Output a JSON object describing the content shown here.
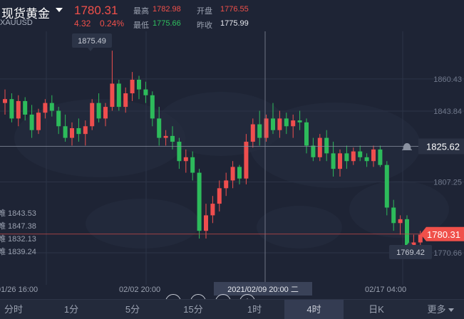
{
  "header": {
    "name": "现货黄金",
    "symbol": "XAUUSD",
    "price": "1780.31",
    "change": "4.32",
    "change_pct": "0.24%",
    "stats": {
      "high_label": "最高",
      "high": "1782.98",
      "open_label": "开盘",
      "open": "1776.55",
      "low_label": "最低",
      "low": "1775.66",
      "prev_label": "昨收",
      "prev": "1775.99"
    }
  },
  "chart": {
    "y_ticks": [
      "1860.43",
      "1843.84",
      "1807.25",
      "1770.66"
    ],
    "crosshair_price": "1825.62",
    "last_price": "1780.31",
    "high_callout": "1875.49",
    "low_callout": "1769.42",
    "ma_legend": [
      "1843.53",
      "1847.38",
      "1832.13",
      "1839.24"
    ],
    "x_ticks": [
      "01/26 16:00",
      "02/02 20:00",
      "02/17 04:00"
    ],
    "crosshair_time": "2021/02/09 20:00 二",
    "colors": {
      "up": "#ef4e4e",
      "down": "#2dbb5b",
      "bg": "#1e2435"
    }
  },
  "chart_data": {
    "type": "candlestick",
    "ylim": [
      1760,
      1885
    ],
    "y_ticks": [
      1860.43,
      1843.84,
      1807.25,
      1770.66
    ],
    "x_ticks": [
      "01/26 16:00",
      "02/02 20:00",
      "02/17 04:00"
    ],
    "ohlc": [
      [
        1848,
        1855,
        1842,
        1850
      ],
      [
        1850,
        1853,
        1838,
        1840
      ],
      [
        1840,
        1852,
        1836,
        1849
      ],
      [
        1849,
        1851,
        1839,
        1842
      ],
      [
        1842,
        1847,
        1830,
        1834
      ],
      [
        1834,
        1845,
        1832,
        1843
      ],
      [
        1843,
        1850,
        1840,
        1848
      ],
      [
        1848,
        1852,
        1841,
        1844
      ],
      [
        1844,
        1846,
        1832,
        1836
      ],
      [
        1836,
        1842,
        1828,
        1830
      ],
      [
        1830,
        1838,
        1826,
        1835
      ],
      [
        1835,
        1840,
        1828,
        1832
      ],
      [
        1832,
        1839,
        1826,
        1836
      ],
      [
        1836,
        1850,
        1834,
        1848
      ],
      [
        1848,
        1853,
        1838,
        1840
      ],
      [
        1840,
        1848,
        1836,
        1846
      ],
      [
        1846,
        1875,
        1844,
        1858
      ],
      [
        1858,
        1860,
        1844,
        1846
      ],
      [
        1846,
        1856,
        1843,
        1853
      ],
      [
        1853,
        1864,
        1849,
        1860
      ],
      [
        1860,
        1862,
        1850,
        1855
      ],
      [
        1855,
        1859,
        1848,
        1852
      ],
      [
        1852,
        1854,
        1836,
        1840
      ],
      [
        1840,
        1846,
        1826,
        1830
      ],
      [
        1830,
        1834,
        1826,
        1831
      ],
      [
        1831,
        1836,
        1824,
        1828
      ],
      [
        1828,
        1830,
        1814,
        1818
      ],
      [
        1818,
        1824,
        1812,
        1820
      ],
      [
        1820,
        1823,
        1808,
        1812
      ],
      [
        1812,
        1814,
        1778,
        1782
      ],
      [
        1782,
        1796,
        1778,
        1790
      ],
      [
        1790,
        1800,
        1786,
        1796
      ],
      [
        1796,
        1808,
        1792,
        1804
      ],
      [
        1804,
        1812,
        1800,
        1808
      ],
      [
        1808,
        1818,
        1804,
        1815
      ],
      [
        1815,
        1816,
        1806,
        1809
      ],
      [
        1809,
        1832,
        1806,
        1828
      ],
      [
        1828,
        1840,
        1825,
        1837
      ],
      [
        1837,
        1844,
        1826,
        1830
      ],
      [
        1830,
        1842,
        1828,
        1840
      ],
      [
        1840,
        1848,
        1832,
        1834
      ],
      [
        1834,
        1844,
        1830,
        1840
      ],
      [
        1840,
        1843,
        1832,
        1836
      ],
      [
        1836,
        1842,
        1830,
        1839
      ],
      [
        1839,
        1844,
        1834,
        1838
      ],
      [
        1838,
        1840,
        1822,
        1826
      ],
      [
        1826,
        1830,
        1818,
        1820
      ],
      [
        1820,
        1832,
        1818,
        1830
      ],
      [
        1830,
        1834,
        1818,
        1822
      ],
      [
        1822,
        1828,
        1810,
        1814
      ],
      [
        1814,
        1824,
        1810,
        1822
      ],
      [
        1822,
        1826,
        1814,
        1818
      ],
      [
        1818,
        1825,
        1816,
        1823
      ],
      [
        1823,
        1826,
        1818,
        1820
      ],
      [
        1820,
        1822,
        1815,
        1818
      ],
      [
        1818,
        1826,
        1815,
        1824
      ],
      [
        1824,
        1826,
        1815,
        1816
      ],
      [
        1816,
        1818,
        1790,
        1794
      ],
      [
        1794,
        1798,
        1782,
        1786
      ],
      [
        1786,
        1790,
        1780,
        1788
      ],
      [
        1788,
        1790,
        1769,
        1772
      ],
      [
        1772,
        1780,
        1769,
        1776
      ],
      [
        1776,
        1782,
        1774,
        1780
      ]
    ]
  },
  "controls": {
    "zoom_out": "−",
    "prev": "⏮",
    "next": "⏭",
    "zoom_in": "+"
  },
  "tabs": [
    {
      "label": "分时",
      "active": false
    },
    {
      "label": "1分",
      "active": false
    },
    {
      "label": "5分",
      "active": false
    },
    {
      "label": "15分",
      "active": false
    },
    {
      "label": "1时",
      "active": false
    },
    {
      "label": "4时",
      "active": true
    },
    {
      "label": "日K",
      "active": false
    },
    {
      "label": "更多",
      "active": false
    }
  ]
}
